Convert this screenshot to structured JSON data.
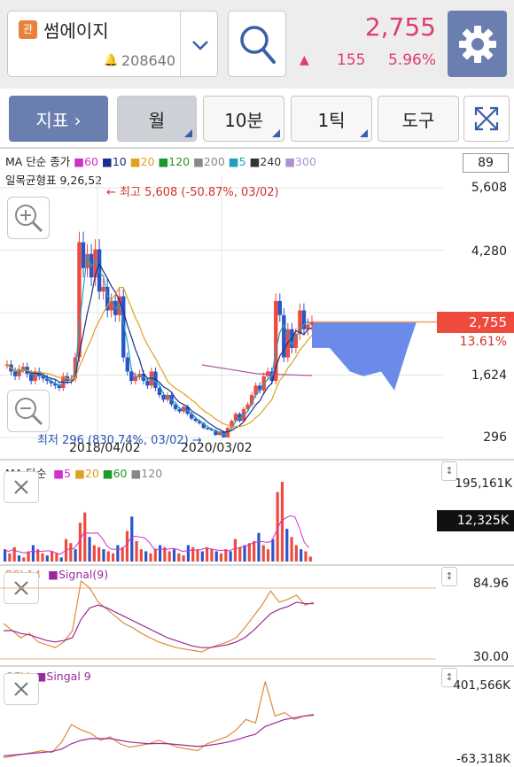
{
  "header": {
    "badge": "관",
    "stock_name": "썸에이지",
    "stock_code": "208640",
    "price": "2,755",
    "change": "155",
    "change_pct": "5.96%",
    "up_color": "#e03c6b"
  },
  "toolbar": {
    "indicator_label": "지표 ›",
    "month_label": "월",
    "min10_label": "10분",
    "tick_label": "1틱",
    "tool_label": "도구"
  },
  "main_pane": {
    "legend_ma": [
      {
        "text": "MA 단순 종가",
        "color": "#222222"
      },
      {
        "text": "■60",
        "color": "#d030c8"
      },
      {
        "text": "■10",
        "color": "#1a2f8a"
      },
      {
        "text": "■20",
        "color": "#e0a020"
      },
      {
        "text": "■120",
        "color": "#1d9a2a"
      },
      {
        "text": "■200",
        "color": "#888888"
      },
      {
        "text": "■5",
        "color": "#20a0c0"
      },
      {
        "text": "■240",
        "color": "#333333"
      },
      {
        "text": "■300",
        "color": "#b090d0"
      }
    ],
    "legend_ichimoku": "일목균형표 9,26,52",
    "ma_box_value": "89",
    "high_annotation": "← 최고 5,608 (-50.87%, 03/02)",
    "low_annotation": "최저 296 (830.74%, 03/02) →",
    "current_price_tag": "2,755",
    "current_pct": "13.61%"
  },
  "volume_pane": {
    "legend_title": "MA 단순",
    "legend_items": [
      {
        "text": "■5",
        "color": "#d030c8"
      },
      {
        "text": "■20",
        "color": "#e0a020"
      },
      {
        "text": "■60",
        "color": "#1d9a2a"
      },
      {
        "text": "■120",
        "color": "#888888"
      }
    ],
    "max_label": "195,161K",
    "current_tag": "12,325K"
  },
  "rsi_pane": {
    "legend_rsi": "RSI 14",
    "legend_signal": "■Signal(9)",
    "top_label": "84.96",
    "bottom_label": "30.00"
  },
  "obv_pane": {
    "legend_obv": "OBV",
    "legend_signal": "■Singal 9",
    "top_label": "401,566K",
    "bottom_label": "-63,318K"
  },
  "chart_data": [
    {
      "type": "candlestick",
      "title": "",
      "x_tick_labels": [
        "2018/04/02",
        "2020/03/02"
      ],
      "y_ticks": [
        5608,
        4280,
        2952,
        1624,
        296
      ],
      "ylim": [
        296,
        5608
      ],
      "high": 5608,
      "low": 296,
      "current": 2755,
      "moving_averages": [
        "5",
        "10",
        "20",
        "60",
        "120",
        "200",
        "240",
        "300"
      ],
      "close_series": [
        1850,
        1700,
        1600,
        1750,
        1800,
        1650,
        1500,
        1700,
        1600,
        1550,
        1500,
        1450,
        1400,
        1350,
        1600,
        1500,
        1550,
        2000,
        4450,
        3900,
        4200,
        3700,
        4300,
        3400,
        3500,
        3000,
        3200,
        2900,
        3300,
        2000,
        1700,
        1500,
        1600,
        1650,
        1500,
        1400,
        1700,
        1350,
        1200,
        1100,
        1200,
        1000,
        900,
        850,
        950,
        800,
        700,
        650,
        600,
        500,
        480,
        450,
        350,
        420,
        300,
        500,
        650,
        800,
        650,
        900,
        1000,
        1200,
        1400,
        1300,
        1600,
        1700,
        1500,
        3200,
        2900,
        2000,
        2600,
        2200,
        2500,
        3000,
        2600,
        2700,
        2755
      ],
      "cloud_top": 2755,
      "cloud_bottom_min": 1300
    },
    {
      "type": "bar",
      "title": "",
      "series": [
        {
          "name": "Volume",
          "values": [
            30,
            20,
            35,
            15,
            10,
            25,
            40,
            30,
            20,
            15,
            25,
            20,
            10,
            55,
            45,
            30,
            95,
            120,
            60,
            40,
            35,
            30,
            25,
            20,
            40,
            35,
            75,
            110,
            50,
            30,
            25,
            20,
            30,
            40,
            35,
            25,
            30,
            20,
            15,
            40,
            35,
            30,
            25,
            35,
            30,
            25,
            20,
            30,
            25,
            55,
            35,
            40,
            45,
            50,
            70,
            40,
            30,
            55,
            170,
            195,
            80,
            60,
            40,
            30,
            25,
            12
          ]
        }
      ],
      "ylim": [
        0,
        195161
      ],
      "y_unit": "K"
    },
    {
      "type": "line",
      "title": "",
      "series": [
        {
          "name": "RSI 14",
          "values": [
            55,
            50,
            45,
            48,
            42,
            40,
            38,
            42,
            50,
            85,
            80,
            70,
            65,
            60,
            55,
            52,
            48,
            45,
            42,
            40,
            38,
            37,
            36,
            35,
            38,
            40,
            42,
            45,
            52,
            60,
            68,
            78,
            70,
            72,
            75,
            68,
            70
          ]
        },
        {
          "name": "Signal(9)",
          "values": [
            50,
            50,
            48,
            47,
            45,
            43,
            42,
            43,
            45,
            58,
            66,
            68,
            66,
            63,
            60,
            57,
            54,
            51,
            48,
            45,
            43,
            41,
            39,
            38,
            38,
            39,
            40,
            42,
            45,
            50,
            56,
            62,
            65,
            67,
            70,
            69,
            69
          ]
        }
      ],
      "ylim": [
        30.0,
        84.96
      ]
    },
    {
      "type": "line",
      "title": "",
      "series": [
        {
          "name": "OBV",
          "values": [
            -40,
            -30,
            -20,
            -10,
            0,
            -10,
            50,
            150,
            120,
            100,
            60,
            80,
            40,
            20,
            30,
            40,
            60,
            40,
            20,
            10,
            0,
            40,
            60,
            80,
            120,
            180,
            160,
            400,
            200,
            220,
            180,
            200,
            210
          ]
        },
        {
          "name": "Singal 9",
          "values": [
            -30,
            -25,
            -20,
            -15,
            -10,
            -5,
            10,
            40,
            60,
            70,
            70,
            70,
            60,
            50,
            45,
            40,
            42,
            40,
            35,
            30,
            25,
            30,
            38,
            48,
            62,
            80,
            95,
            140,
            160,
            180,
            190,
            200,
            205
          ]
        }
      ],
      "ylim": [
        -63318,
        401566
      ],
      "y_unit": "K"
    }
  ]
}
